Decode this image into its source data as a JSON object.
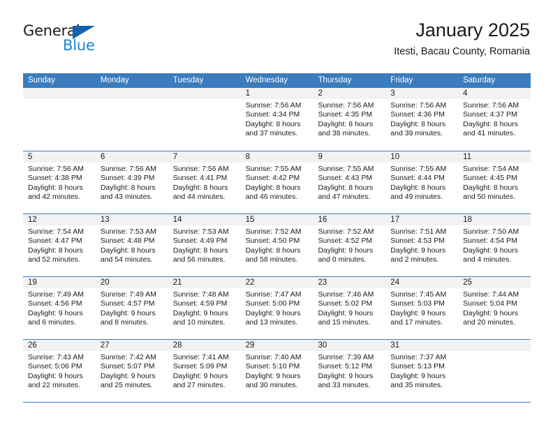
{
  "brand": {
    "name_top": "General",
    "name_bottom": "Blue",
    "color_dark": "#1a1a1a",
    "color_blue": "#1a84d6",
    "triangle_color": "#1263ad"
  },
  "header": {
    "title": "January 2025",
    "subtitle": "Itesti, Bacau County, Romania"
  },
  "theme": {
    "header_band": "#3a7cbe",
    "daynum_band": "#f2f2f2",
    "text": "#1a1a1a"
  },
  "weekdays": [
    "Sunday",
    "Monday",
    "Tuesday",
    "Wednesday",
    "Thursday",
    "Friday",
    "Saturday"
  ],
  "weeks": [
    [
      {
        "day": "",
        "lines": []
      },
      {
        "day": "",
        "lines": []
      },
      {
        "day": "",
        "lines": []
      },
      {
        "day": "1",
        "lines": [
          "Sunrise: 7:56 AM",
          "Sunset: 4:34 PM",
          "Daylight: 8 hours",
          "and 37 minutes."
        ]
      },
      {
        "day": "2",
        "lines": [
          "Sunrise: 7:56 AM",
          "Sunset: 4:35 PM",
          "Daylight: 8 hours",
          "and 38 minutes."
        ]
      },
      {
        "day": "3",
        "lines": [
          "Sunrise: 7:56 AM",
          "Sunset: 4:36 PM",
          "Daylight: 8 hours",
          "and 39 minutes."
        ]
      },
      {
        "day": "4",
        "lines": [
          "Sunrise: 7:56 AM",
          "Sunset: 4:37 PM",
          "Daylight: 8 hours",
          "and 41 minutes."
        ]
      }
    ],
    [
      {
        "day": "5",
        "lines": [
          "Sunrise: 7:56 AM",
          "Sunset: 4:38 PM",
          "Daylight: 8 hours",
          "and 42 minutes."
        ]
      },
      {
        "day": "6",
        "lines": [
          "Sunrise: 7:56 AM",
          "Sunset: 4:39 PM",
          "Daylight: 8 hours",
          "and 43 minutes."
        ]
      },
      {
        "day": "7",
        "lines": [
          "Sunrise: 7:56 AM",
          "Sunset: 4:41 PM",
          "Daylight: 8 hours",
          "and 44 minutes."
        ]
      },
      {
        "day": "8",
        "lines": [
          "Sunrise: 7:55 AM",
          "Sunset: 4:42 PM",
          "Daylight: 8 hours",
          "and 46 minutes."
        ]
      },
      {
        "day": "9",
        "lines": [
          "Sunrise: 7:55 AM",
          "Sunset: 4:43 PM",
          "Daylight: 8 hours",
          "and 47 minutes."
        ]
      },
      {
        "day": "10",
        "lines": [
          "Sunrise: 7:55 AM",
          "Sunset: 4:44 PM",
          "Daylight: 8 hours",
          "and 49 minutes."
        ]
      },
      {
        "day": "11",
        "lines": [
          "Sunrise: 7:54 AM",
          "Sunset: 4:45 PM",
          "Daylight: 8 hours",
          "and 50 minutes."
        ]
      }
    ],
    [
      {
        "day": "12",
        "lines": [
          "Sunrise: 7:54 AM",
          "Sunset: 4:47 PM",
          "Daylight: 8 hours",
          "and 52 minutes."
        ]
      },
      {
        "day": "13",
        "lines": [
          "Sunrise: 7:53 AM",
          "Sunset: 4:48 PM",
          "Daylight: 8 hours",
          "and 54 minutes."
        ]
      },
      {
        "day": "14",
        "lines": [
          "Sunrise: 7:53 AM",
          "Sunset: 4:49 PM",
          "Daylight: 8 hours",
          "and 56 minutes."
        ]
      },
      {
        "day": "15",
        "lines": [
          "Sunrise: 7:52 AM",
          "Sunset: 4:50 PM",
          "Daylight: 8 hours",
          "and 58 minutes."
        ]
      },
      {
        "day": "16",
        "lines": [
          "Sunrise: 7:52 AM",
          "Sunset: 4:52 PM",
          "Daylight: 9 hours",
          "and 0 minutes."
        ]
      },
      {
        "day": "17",
        "lines": [
          "Sunrise: 7:51 AM",
          "Sunset: 4:53 PM",
          "Daylight: 9 hours",
          "and 2 minutes."
        ]
      },
      {
        "day": "18",
        "lines": [
          "Sunrise: 7:50 AM",
          "Sunset: 4:54 PM",
          "Daylight: 9 hours",
          "and 4 minutes."
        ]
      }
    ],
    [
      {
        "day": "19",
        "lines": [
          "Sunrise: 7:49 AM",
          "Sunset: 4:56 PM",
          "Daylight: 9 hours",
          "and 6 minutes."
        ]
      },
      {
        "day": "20",
        "lines": [
          "Sunrise: 7:49 AM",
          "Sunset: 4:57 PM",
          "Daylight: 9 hours",
          "and 8 minutes."
        ]
      },
      {
        "day": "21",
        "lines": [
          "Sunrise: 7:48 AM",
          "Sunset: 4:59 PM",
          "Daylight: 9 hours",
          "and 10 minutes."
        ]
      },
      {
        "day": "22",
        "lines": [
          "Sunrise: 7:47 AM",
          "Sunset: 5:00 PM",
          "Daylight: 9 hours",
          "and 13 minutes."
        ]
      },
      {
        "day": "23",
        "lines": [
          "Sunrise: 7:46 AM",
          "Sunset: 5:02 PM",
          "Daylight: 9 hours",
          "and 15 minutes."
        ]
      },
      {
        "day": "24",
        "lines": [
          "Sunrise: 7:45 AM",
          "Sunset: 5:03 PM",
          "Daylight: 9 hours",
          "and 17 minutes."
        ]
      },
      {
        "day": "25",
        "lines": [
          "Sunrise: 7:44 AM",
          "Sunset: 5:04 PM",
          "Daylight: 9 hours",
          "and 20 minutes."
        ]
      }
    ],
    [
      {
        "day": "26",
        "lines": [
          "Sunrise: 7:43 AM",
          "Sunset: 5:06 PM",
          "Daylight: 9 hours",
          "and 22 minutes."
        ]
      },
      {
        "day": "27",
        "lines": [
          "Sunrise: 7:42 AM",
          "Sunset: 5:07 PM",
          "Daylight: 9 hours",
          "and 25 minutes."
        ]
      },
      {
        "day": "28",
        "lines": [
          "Sunrise: 7:41 AM",
          "Sunset: 5:09 PM",
          "Daylight: 9 hours",
          "and 27 minutes."
        ]
      },
      {
        "day": "29",
        "lines": [
          "Sunrise: 7:40 AM",
          "Sunset: 5:10 PM",
          "Daylight: 9 hours",
          "and 30 minutes."
        ]
      },
      {
        "day": "30",
        "lines": [
          "Sunrise: 7:39 AM",
          "Sunset: 5:12 PM",
          "Daylight: 9 hours",
          "and 33 minutes."
        ]
      },
      {
        "day": "31",
        "lines": [
          "Sunrise: 7:37 AM",
          "Sunset: 5:13 PM",
          "Daylight: 9 hours",
          "and 35 minutes."
        ]
      },
      {
        "day": "",
        "lines": []
      }
    ]
  ]
}
